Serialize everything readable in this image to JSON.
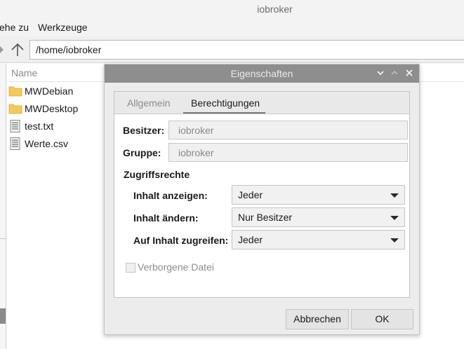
{
  "window": {
    "title": "iobroker"
  },
  "menubar": {
    "items": [
      "ehe zu",
      "Werkzeuge"
    ]
  },
  "toolbar": {
    "path": "/home/iobroker"
  },
  "filelist": {
    "column_name": "Name",
    "items": [
      {
        "name": "MWDebian",
        "icon": "folder-icon"
      },
      {
        "name": "MWDesktop",
        "icon": "folder-icon"
      },
      {
        "name": "test.txt",
        "icon": "text-file-icon"
      },
      {
        "name": "Werte.csv",
        "icon": "text-file-icon"
      }
    ]
  },
  "dialog": {
    "title": "Eigenschaften",
    "tabs": [
      {
        "label": "Allgemein",
        "active": false
      },
      {
        "label": "Berechtigungen",
        "active": true
      }
    ],
    "owner": {
      "label": "Besitzer:",
      "value": "iobroker"
    },
    "group": {
      "label": "Gruppe:",
      "value": "iobroker"
    },
    "access_heading": "Zugriffsrechte",
    "permissions": [
      {
        "label": "Inhalt anzeigen:",
        "value": "Jeder"
      },
      {
        "label": "Inhalt ändern:",
        "value": "Nur Besitzer"
      },
      {
        "label": "Auf Inhalt zugreifen:",
        "value": "Jeder"
      }
    ],
    "hidden_file": {
      "label": "Verborgene Datei",
      "checked": false
    },
    "buttons": {
      "cancel": "Abbrechen",
      "ok": "OK"
    }
  },
  "colors": {
    "dialog_titlebar": "#8e8e8e",
    "folder": "#f6c85a"
  }
}
